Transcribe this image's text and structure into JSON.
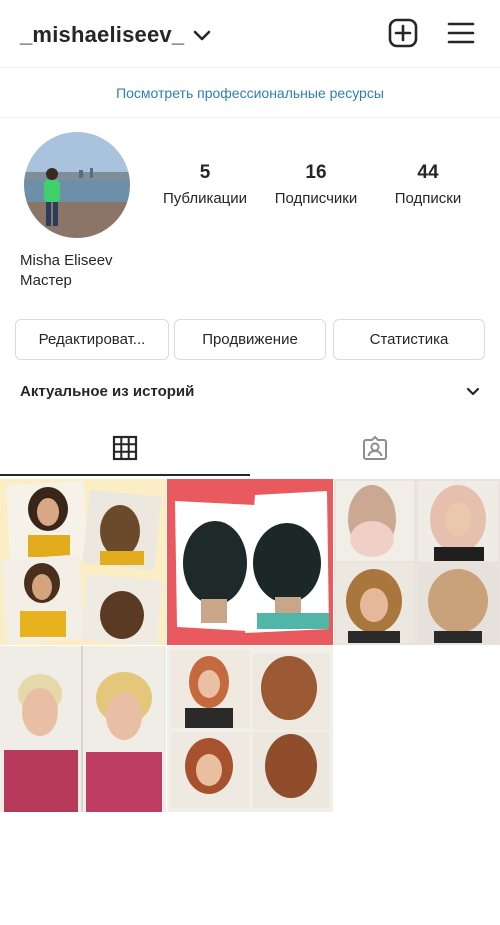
{
  "header": {
    "username": "_mishaeliseev_",
    "chevron_icon": "chevron-down-icon",
    "add_icon": "plus-square-icon",
    "menu_icon": "hamburger-menu-icon"
  },
  "pro_link": "Посмотреть профессиональные ресурсы",
  "profile": {
    "name": "Misha Eliseev",
    "category": "Мастер"
  },
  "stats": {
    "posts": {
      "value": "5",
      "label": "Публикации"
    },
    "followers": {
      "value": "16",
      "label": "Подписчики"
    },
    "following": {
      "value": "44",
      "label": "Подписки"
    }
  },
  "buttons": {
    "edit": "Редактироват...",
    "promote": "Продвижение",
    "insights": "Статистика"
  },
  "highlights": {
    "label": "Актуальное из историй"
  },
  "tabs": {
    "grid_icon": "grid-icon",
    "tagged_icon": "tagged-person-icon"
  },
  "colors": {
    "link": "#2f7fb2",
    "text": "#262626",
    "border": "#dbdbdb"
  }
}
